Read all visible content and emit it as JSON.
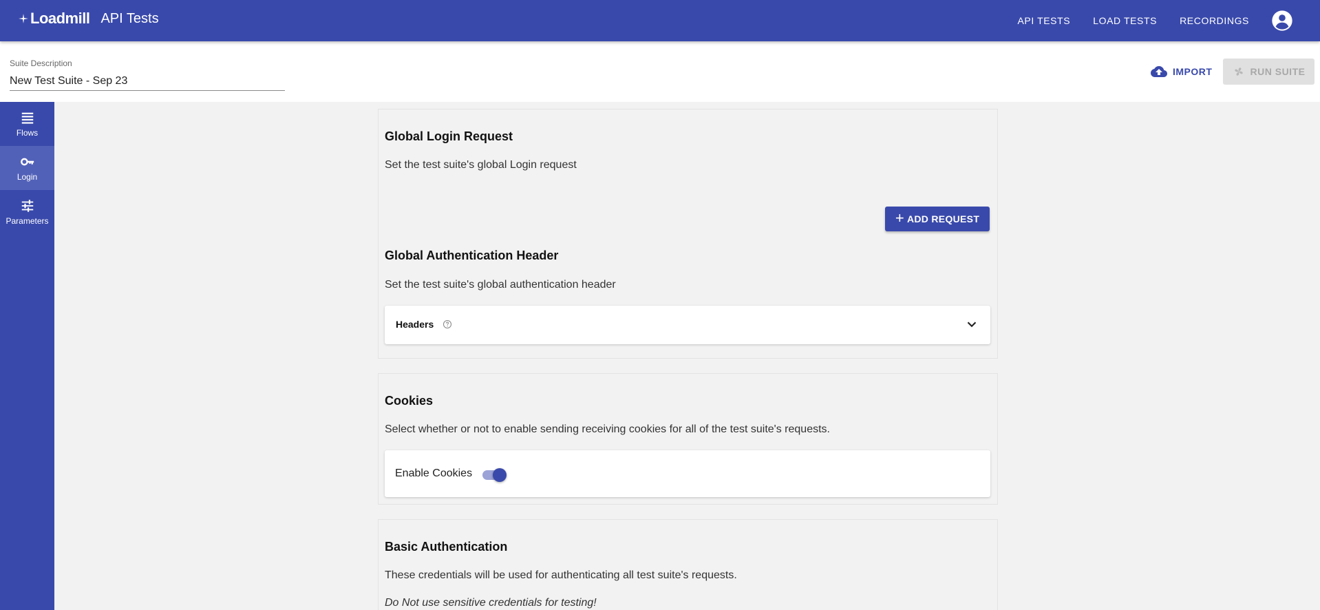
{
  "brand": {
    "logo": "Loadmill",
    "app_title": "API Tests"
  },
  "nav": {
    "items": [
      "API TESTS",
      "LOAD TESTS",
      "RECORDINGS"
    ],
    "account_icon": "account-circle-icon"
  },
  "suite": {
    "description_label": "Suite Description",
    "description_value": "New Test Suite - Sep 23",
    "import_label": "IMPORT",
    "run_label": "RUN SUITE"
  },
  "sidebar": {
    "items": [
      {
        "label": "Flows",
        "icon": "list-icon",
        "active": false
      },
      {
        "label": "Login",
        "icon": "key-icon",
        "active": true
      },
      {
        "label": "Parameters",
        "icon": "tune-icon",
        "active": false
      }
    ]
  },
  "login_card": {
    "title": "Global Login Request",
    "description": "Set the test suite's global Login request",
    "add_request_label": "ADD REQUEST",
    "auth_title": "Global Authentication Header",
    "auth_description": "Set the test suite's global authentication header",
    "headers_label": "Headers"
  },
  "cookies_card": {
    "title": "Cookies",
    "description": "Select whether or not to enable sending receiving cookies for all of the test suite's requests.",
    "toggle_label": "Enable Cookies",
    "enabled": true
  },
  "basic_auth_card": {
    "title": "Basic Authentication",
    "description": "These credentials will be used for authenticating all test suite's requests.",
    "warning": "Do Not use sensitive credentials for testing!"
  },
  "colors": {
    "primary": "#3949ab",
    "sidebar_active": "#5261b8",
    "background": "#f2f2f2"
  }
}
